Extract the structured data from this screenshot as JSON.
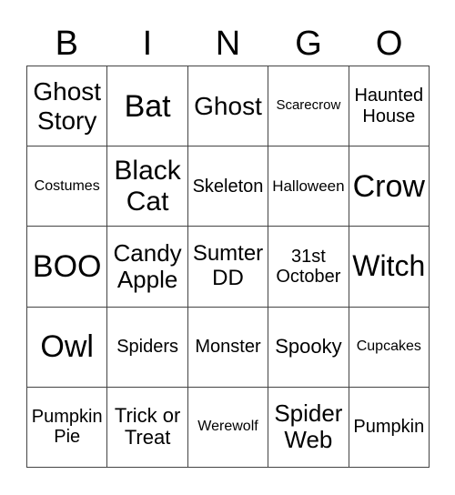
{
  "header": [
    "B",
    "I",
    "N",
    "G",
    "O"
  ],
  "cells": [
    "Ghost\nStory",
    "Bat",
    "Ghost",
    "Scarecrow",
    "Haunted\nHouse",
    "Costumes",
    "Black\nCat",
    "Skeleton",
    "Halloween",
    "Crow",
    "BOO",
    "Candy\nApple",
    "Sumter\nDD",
    "31st\nOctober",
    "Witch",
    "Owl",
    "Spiders",
    "Monster",
    "Spooky",
    "Cupcakes",
    "Pumpkin\nPie",
    "Trick or\nTreat",
    "Werewolf",
    "Spider\nWeb",
    "Pumpkin"
  ]
}
